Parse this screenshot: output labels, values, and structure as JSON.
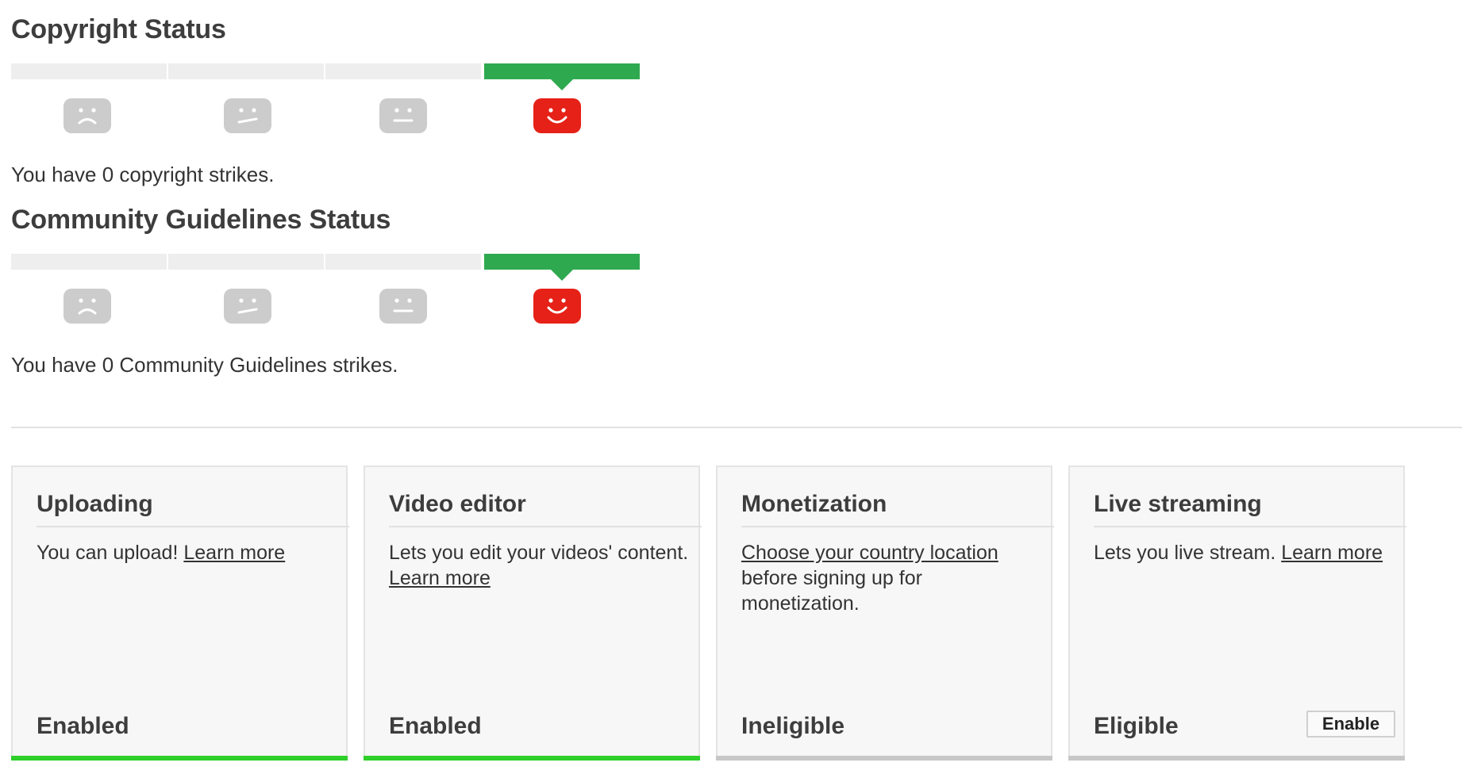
{
  "copyright": {
    "title": "Copyright Status",
    "strike_text": "You have 0 copyright strikes.",
    "faces": [
      "sad-face-icon",
      "unsure-face-icon",
      "neutral-face-icon",
      "happy-face-icon"
    ],
    "active_index": 3
  },
  "community": {
    "title": "Community Guidelines Status",
    "strike_text": "You have 0 Community Guidelines strikes.",
    "faces": [
      "sad-face-icon",
      "unsure-face-icon",
      "neutral-face-icon",
      "happy-face-icon"
    ],
    "active_index": 3
  },
  "colors": {
    "active_segment": "#2ea94f",
    "inactive_segment": "#eeeeee",
    "active_face": "#e62117",
    "inactive_face": "#cccccc",
    "enabled_bar": "#2fd02a",
    "disabled_bar": "#c7c7c7"
  },
  "cards": [
    {
      "title": "Uploading",
      "desc_text": "You can upload! ",
      "link": "Learn more",
      "status": "Enabled"
    },
    {
      "title": "Video editor",
      "desc_text": "Lets you edit your videos' content.",
      "link": "Learn more",
      "status": "Enabled"
    },
    {
      "title": "Monetization",
      "link": "Choose your country location",
      "desc_text": "before signing up for monetization.",
      "status": "Ineligible"
    },
    {
      "title": "Live streaming",
      "desc_text": "Lets you live stream. ",
      "link": "Learn more",
      "status": "Eligible",
      "button": "Enable"
    }
  ]
}
